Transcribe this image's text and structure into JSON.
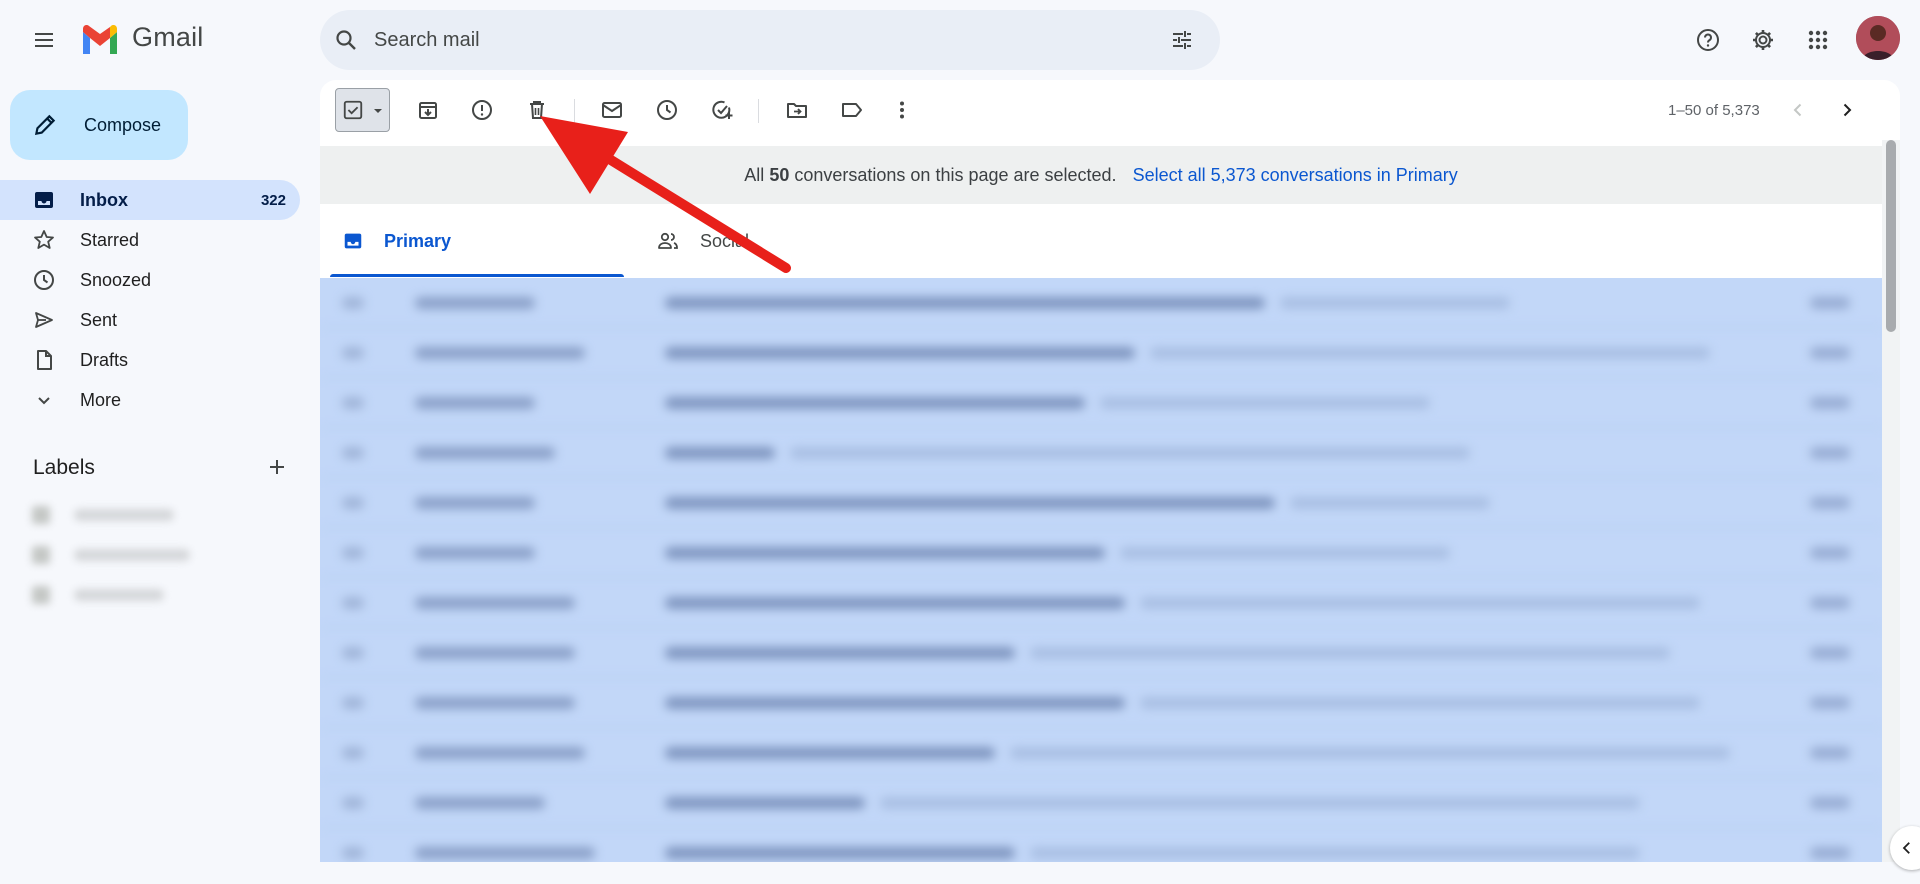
{
  "app": {
    "logo_text": "Gmail",
    "accent": "#0b57d0",
    "selected_row_color": "#c2d7f8"
  },
  "search": {
    "placeholder": "Search mail"
  },
  "compose": {
    "label": "Compose"
  },
  "sidebar": {
    "items": [
      {
        "label": "Inbox",
        "count": "322",
        "icon": "inbox-icon",
        "active": true
      },
      {
        "label": "Starred",
        "icon": "star-icon"
      },
      {
        "label": "Snoozed",
        "icon": "clock-icon"
      },
      {
        "label": "Sent",
        "icon": "send-icon"
      },
      {
        "label": "Drafts",
        "icon": "draft-icon"
      },
      {
        "label": "More",
        "icon": "chevron-down-icon"
      }
    ],
    "labels_title": "Labels"
  },
  "toolbar": {
    "actions": [
      "select-all-checkbox",
      "archive-icon",
      "report-spam-icon",
      "delete-icon",
      "mark-as-read-icon",
      "snooze-icon",
      "add-to-tasks-icon",
      "move-to-icon",
      "label-icon",
      "more-vert-icon"
    ],
    "pager_text": "1–50 of 5,373"
  },
  "banner": {
    "prefix": "All",
    "count": "50",
    "suffix": "conversations on this page are selected.",
    "link": "Select all 5,373 conversations in Primary"
  },
  "tabs": [
    {
      "label": "Primary",
      "icon": "inbox-icon",
      "active": true
    },
    {
      "label": "Social",
      "icon": "people-icon"
    }
  ],
  "annotation": {
    "arrow_color": "#e8201a",
    "points_to": "delete-icon"
  }
}
